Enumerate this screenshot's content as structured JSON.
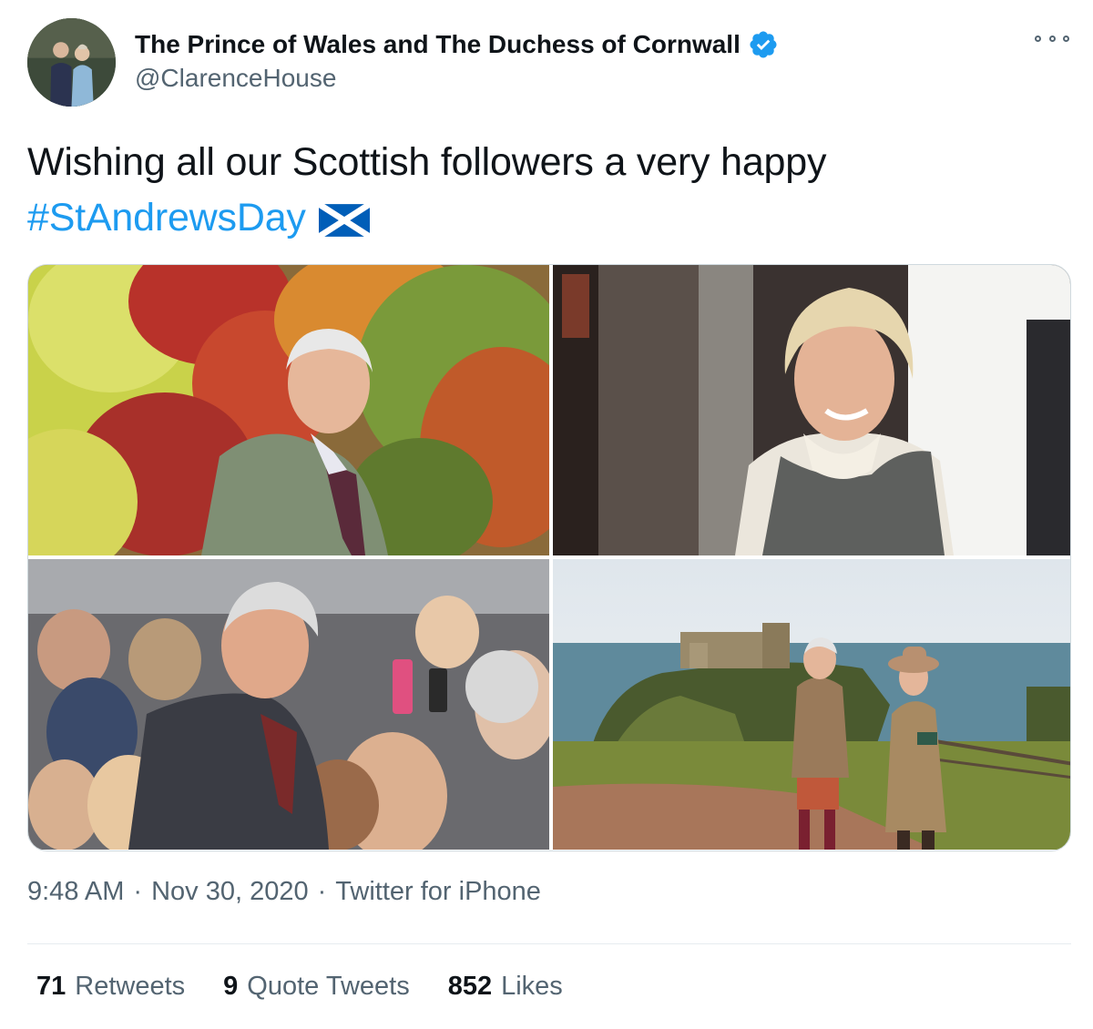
{
  "author": {
    "display_name": "The Prince of Wales and The Duchess of Cornwall",
    "handle": "@ClarenceHouse",
    "verified": true,
    "verified_color": "#1d9bf0"
  },
  "tweet": {
    "text": "Wishing all our Scottish followers a very happy",
    "hashtag": "#StAndrewsDay",
    "emoji": "scotland-flag-icon",
    "hashtag_color": "#1d9bf0"
  },
  "media": {
    "photos": [
      {
        "subject": "photo-prince-autumn-garden"
      },
      {
        "subject": "photo-duchess-smiling"
      },
      {
        "subject": "photo-prince-crowd"
      },
      {
        "subject": "photo-couple-castle-cliff"
      }
    ]
  },
  "meta": {
    "time": "9:48 AM",
    "separator": "·",
    "date": "Nov 30, 2020",
    "source": "Twitter for iPhone"
  },
  "stats": {
    "retweets_count": "71",
    "retweets_label": "Retweets",
    "quotes_count": "9",
    "quotes_label": "Quote Tweets",
    "likes_count": "852",
    "likes_label": "Likes"
  }
}
